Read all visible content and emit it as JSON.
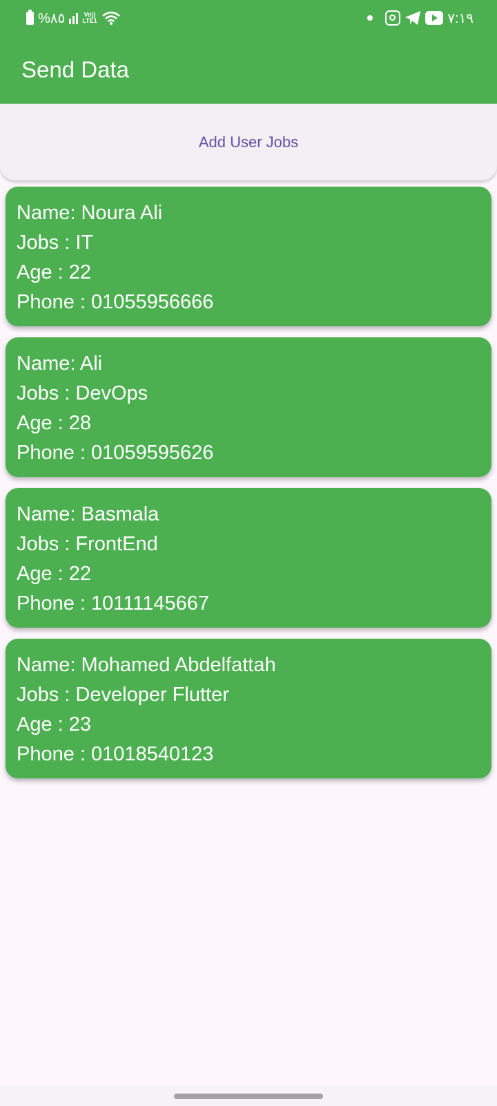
{
  "status_bar": {
    "battery": "%٨٥",
    "network": "LTE1",
    "network_top": "Vo))",
    "time": "٧:١٩",
    "icons": [
      "battery-icon",
      "signal-icon",
      "wifi-icon",
      "dot-icon",
      "instagram-icon",
      "telegram-icon",
      "youtube-icon"
    ]
  },
  "app_bar": {
    "title": "Send Data"
  },
  "actions": {
    "add_label": "Add User Jobs"
  },
  "users": [
    {
      "name": "Name: Noura Ali",
      "job": "Jobs : IT",
      "age": "Age : 22",
      "phone": "Phone : 01055956666"
    },
    {
      "name": "Name: Ali",
      "job": "Jobs : DevOps",
      "age": "Age : 28",
      "phone": "Phone : 01059595626"
    },
    {
      "name": "Name: Basmala",
      "job": "Jobs : FrontEnd",
      "age": "Age : 22",
      "phone": "Phone : 10111145667"
    },
    {
      "name": "Name: Mohamed Abdelfattah",
      "job": "Jobs : Developer Flutter",
      "age": "Age : 23",
      "phone": "Phone : 01018540123"
    }
  ],
  "colors": {
    "primary": "#4caf50",
    "button_text": "#6750a4",
    "background": "#fdf7fd"
  }
}
